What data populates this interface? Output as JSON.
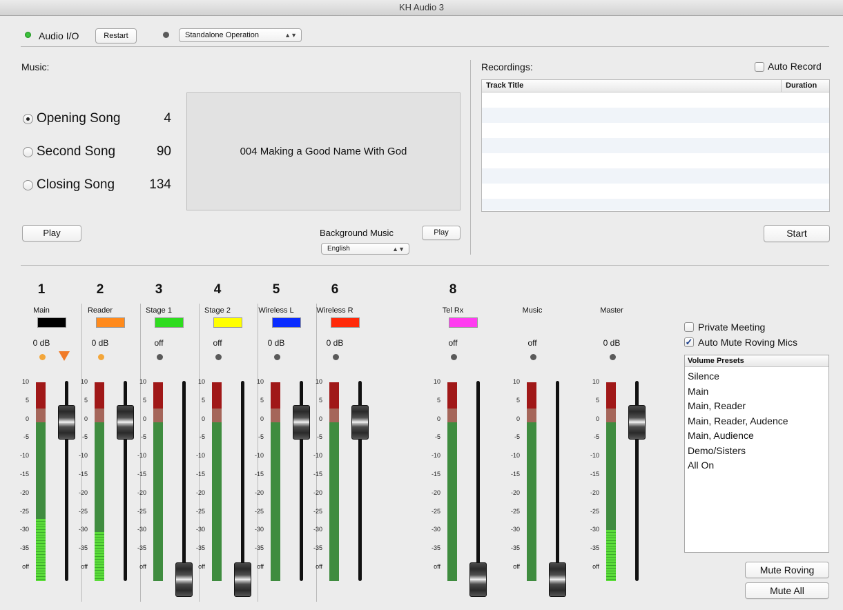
{
  "window": {
    "title": "KH Audio 3"
  },
  "topbar": {
    "audio_io_label": "Audio I/O",
    "restart_label": "Restart",
    "operation_mode": "Standalone Operation",
    "led_audio_color": "#3cc23c",
    "led_mode_color": "#5a5a5a"
  },
  "music": {
    "heading": "Music:",
    "songs": [
      {
        "label": "Opening Song",
        "number": "4",
        "selected": true
      },
      {
        "label": "Second Song",
        "number": "90",
        "selected": false
      },
      {
        "label": "Closing Song",
        "number": "134",
        "selected": false
      }
    ],
    "now_title": "004 Making a Good Name With God",
    "play_label": "Play",
    "background_label": "Background Music",
    "background_play_label": "Play",
    "language": "English"
  },
  "recordings": {
    "heading": "Recordings:",
    "auto_record_label": "Auto Record",
    "columns": [
      "Track Title",
      "Duration"
    ],
    "start_label": "Start"
  },
  "channels": [
    {
      "number": "1",
      "name": "Main",
      "color": "#000000",
      "db": "0 dB",
      "level": 0.57,
      "fader": "0 dB"
    },
    {
      "number": "2",
      "name": "Reader",
      "color": "#ff8a1c",
      "db": "0 dB",
      "level": 0.45,
      "fader": "0 dB"
    },
    {
      "number": "3",
      "name": "Stage 1",
      "color": "#2fdc1f",
      "db": "off",
      "level": 0,
      "fader": "off"
    },
    {
      "number": "4",
      "name": "Stage 2",
      "color": "#ffff00",
      "db": "off",
      "level": 0,
      "fader": "off"
    },
    {
      "number": "5",
      "name": "Wireless L",
      "color": "#0a2cff",
      "db": "0 dB",
      "level": 0,
      "fader": "0 dB"
    },
    {
      "number": "6",
      "name": "Wireless R",
      "color": "#ff2a0a",
      "db": "0 dB",
      "level": 0,
      "fader": "0 dB"
    },
    {
      "number": "8",
      "name": "Tel Rx",
      "color": "#ff3cf0",
      "db": "off",
      "level": 0,
      "fader": "off"
    },
    {
      "number": "",
      "name": "Music",
      "color": "",
      "db": "off",
      "level": 0,
      "fader": "off"
    },
    {
      "number": "",
      "name": "Master",
      "color": "",
      "db": "0 dB",
      "level": 0.47,
      "fader": "0 dB"
    }
  ],
  "meter_scale": [
    "10",
    "5",
    "0",
    "-5",
    "-10",
    "-15",
    "-20",
    "-25",
    "-30",
    "-35",
    "off"
  ],
  "controls": {
    "private_meeting_label": "Private Meeting",
    "private_meeting_checked": false,
    "auto_mute_label": "Auto Mute Roving Mics",
    "auto_mute_checked": true,
    "presets_header": "Volume Presets",
    "presets": [
      "Silence",
      "Main",
      "Main, Reader",
      "Main, Reader, Audence",
      "Main, Audience",
      "Demo/Sisters",
      "All On"
    ],
    "mute_roving_label": "Mute Roving",
    "mute_all_label": "Mute All"
  }
}
